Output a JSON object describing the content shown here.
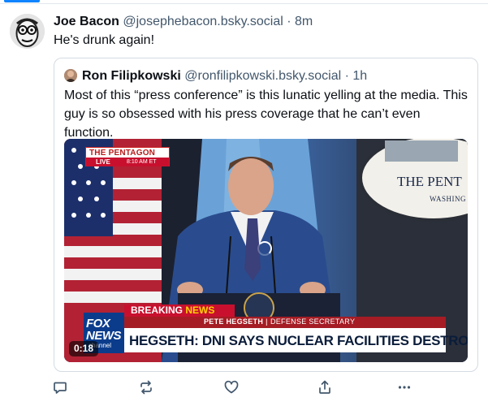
{
  "post": {
    "author_name": "Joe Bacon",
    "author_handle": "@josephebacon.bsky.social",
    "separator": "·",
    "time": "8m",
    "text": "He's drunk again!"
  },
  "quote": {
    "author_name": "Ron Filipkowski",
    "author_handle": "@ronfilipkowski.bsky.social",
    "separator": "·",
    "time": "1h",
    "text": "Most of this “press conference” is this lunatic yelling at the media. This guy is so obsessed with his press coverage that he can’t even function.",
    "video": {
      "duration": "0:18",
      "tag_title": "THE PENTAGON",
      "tag_live": "LIVE",
      "tag_time": "8:10 AM ET",
      "seal_text": "THE PENT",
      "seal_sub": "WASHING",
      "breaking_1": "BREAKING",
      "breaking_2": "NEWS",
      "name_line_name": "PETE HEGSETH",
      "name_line_sep": "|",
      "name_line_title": "DEFENSE SECRETARY",
      "headline": "HEGSETH: DNI SAYS NUCLEAR FACILITIES DESTROYED",
      "logo_line1": "FOX",
      "logo_line2": "NEWS",
      "logo_line3": "channel"
    }
  },
  "actions": {
    "reply_icon": "reply-icon",
    "repost_icon": "repost-icon",
    "like_icon": "heart-icon",
    "share_icon": "share-icon",
    "more_icon": "more-icon"
  },
  "colors": {
    "accent": "#1083fe",
    "muted_text": "#42576c",
    "border": "#d4dbe2",
    "icon": "#42576c"
  }
}
